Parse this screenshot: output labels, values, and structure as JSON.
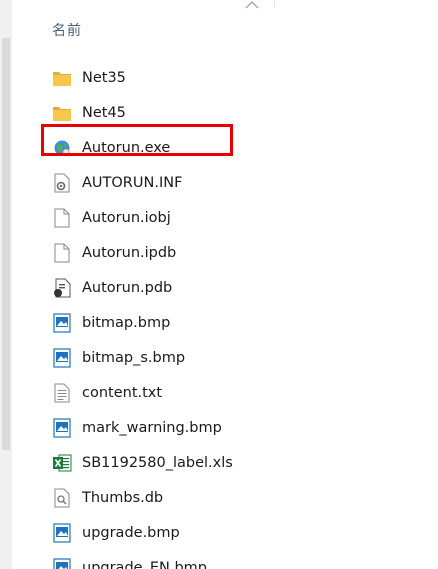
{
  "header": {
    "name_column": "名前"
  },
  "colors": {
    "highlight_border": "#e60000",
    "folder": "#f7c64a",
    "bitmap": "#1e73be",
    "excel": "#1d7a3b",
    "header_text": "#4c607a"
  },
  "files": [
    {
      "name": "Net35",
      "icon": "folder-icon"
    },
    {
      "name": "Net45",
      "icon": "folder-icon"
    },
    {
      "name": "Autorun.exe",
      "icon": "exe-globe-icon",
      "highlighted": true
    },
    {
      "name": "AUTORUN.INF",
      "icon": "inf-settings-icon"
    },
    {
      "name": "Autorun.iobj",
      "icon": "blank-document-icon"
    },
    {
      "name": "Autorun.ipdb",
      "icon": "blank-document-icon"
    },
    {
      "name": "Autorun.pdb",
      "icon": "pdb-document-icon"
    },
    {
      "name": "bitmap.bmp",
      "icon": "bitmap-icon"
    },
    {
      "name": "bitmap_s.bmp",
      "icon": "bitmap-icon"
    },
    {
      "name": "content.txt",
      "icon": "text-document-icon"
    },
    {
      "name": "mark_warning.bmp",
      "icon": "bitmap-icon"
    },
    {
      "name": "SB1192580_label.xls",
      "icon": "excel-icon"
    },
    {
      "name": "Thumbs.db",
      "icon": "thumbs-db-icon"
    },
    {
      "name": "upgrade.bmp",
      "icon": "bitmap-icon"
    },
    {
      "name": "upgrade_EN.bmp",
      "icon": "bitmap-icon"
    }
  ]
}
